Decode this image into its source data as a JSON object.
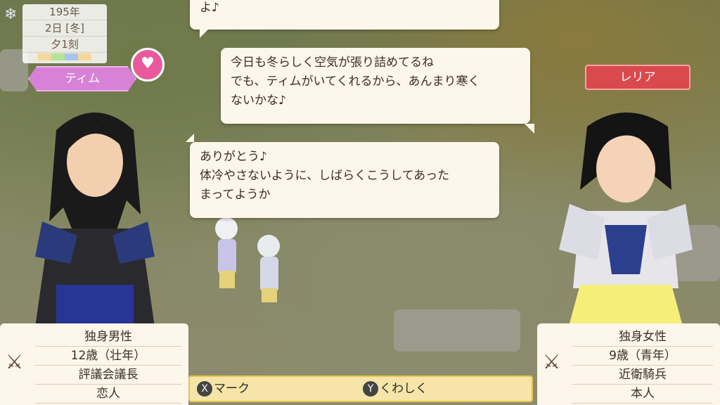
{
  "date": {
    "year": "195年",
    "day": "2日 [冬]",
    "time": "夕1刻",
    "season_colors": [
      "#f2d89b",
      "#b5e39a",
      "#a8c4f0",
      "#f2d89b"
    ]
  },
  "characters": {
    "left": {
      "name": "ティム",
      "info": [
        "独身男性",
        "12歳（壮年）",
        "評議会議長",
        "恋人"
      ]
    },
    "right": {
      "name": "レリア",
      "info": [
        "独身女性",
        "9歳（青年）",
        "近衛騎兵",
        "本人"
      ]
    }
  },
  "dialogue": [
    {
      "speaker": "left",
      "lines": [
        "よ♪"
      ]
    },
    {
      "speaker": "right",
      "lines": [
        "今日も冬らしく空気が張り詰めてるね",
        "でも、ティムがいてくれるから、あんまり寒く",
        "ないかな♪"
      ]
    },
    {
      "speaker": "left",
      "lines": [
        "ありがとう♪",
        "体冷やさないように、しばらくこうしてあった",
        "まってようか"
      ]
    }
  ],
  "actions": {
    "mark": {
      "key": "X",
      "label": "マーク"
    },
    "details": {
      "key": "Y",
      "label": "くわしく"
    }
  },
  "icons": {
    "heart": "heart-icon",
    "swords": "crossed-swords-icon",
    "snowflake": "snowflake-icon"
  }
}
